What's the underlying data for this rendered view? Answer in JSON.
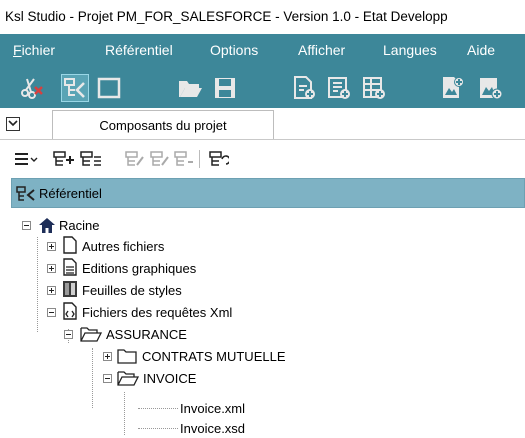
{
  "window": {
    "title": "Ksl Studio - Projet PM_FOR_SALESFORCE - Version 1.0 - Etat Developp"
  },
  "menubar": {
    "items": [
      {
        "accel": "F",
        "rest": "ichier"
      },
      {
        "accel": "",
        "rest": "Référentiel"
      },
      {
        "accel": "",
        "rest": "Options"
      },
      {
        "accel": "",
        "rest": "Afficher"
      },
      {
        "accel": "",
        "rest": "Langues"
      },
      {
        "accel": "",
        "rest": "Aide"
      }
    ]
  },
  "toolbar": {
    "buttons": [
      {
        "icon": "scissors-delete-icon"
      },
      {
        "icon": "repository-icon",
        "selected": true
      },
      {
        "icon": "window-icon"
      },
      {
        "icon": "folder-open-icon"
      },
      {
        "icon": "save-icon"
      },
      {
        "icon": "document-add-icon"
      },
      {
        "icon": "document-add-icon"
      },
      {
        "icon": "grid-add-icon"
      },
      {
        "icon": "image-add-icon"
      },
      {
        "icon": "image-add-icon"
      }
    ]
  },
  "panel": {
    "tab_label": "Composants du projet"
  },
  "tree_toolbar": {
    "buttons": [
      "list-dropdown-icon",
      "add-node-icon",
      "add-list-icon",
      "edit-node-icon",
      "edit-node-disabled-icon",
      "remove-node-disabled-icon",
      "refresh-tree-icon"
    ]
  },
  "repository": {
    "header": "Référentiel",
    "root": "Racine",
    "nodes": [
      {
        "label": "Autres fichiers",
        "expanded": false,
        "icon": "file-icon"
      },
      {
        "label": "Editions graphiques",
        "expanded": false,
        "icon": "report-icon"
      },
      {
        "label": "Feuilles de styles",
        "expanded": false,
        "icon": "stylesheet-icon"
      },
      {
        "label": "Fichiers des requêtes Xml",
        "expanded": true,
        "icon": "xml-file-icon"
      },
      {
        "label": "ASSURANCE",
        "expanded": true,
        "icon": "folder-open-icon"
      },
      {
        "label": "CONTRATS MUTUELLE",
        "expanded": false,
        "icon": "folder-icon"
      },
      {
        "label": "INVOICE",
        "expanded": true,
        "icon": "folder-open-icon"
      },
      {
        "label": "Invoice.xml",
        "icon": "none"
      },
      {
        "label": "Invoice.xsd",
        "icon": "none"
      }
    ]
  }
}
